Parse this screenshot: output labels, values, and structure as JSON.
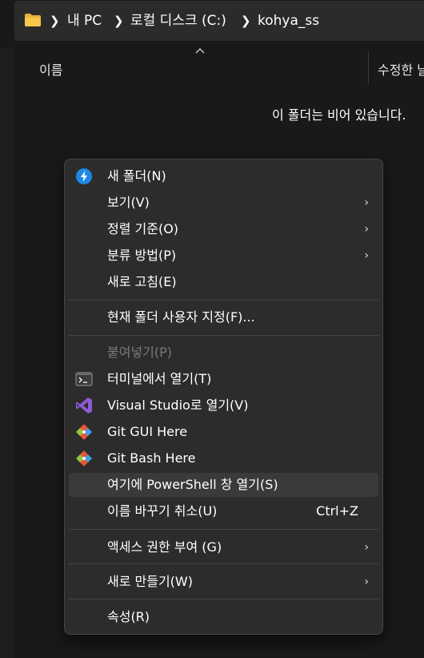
{
  "breadcrumb": {
    "items": [
      "내 PC",
      "로컬 디스크 (C:)",
      "kohya_ss"
    ]
  },
  "columns": {
    "name": "이름",
    "date": "수정한 날"
  },
  "empty_message": "이 폴더는 비어 있습니다.",
  "context_menu": {
    "items": [
      {
        "label": "새 폴더(N)",
        "icon": "new-folder-icon"
      },
      {
        "label": "보기(V)",
        "submenu": true
      },
      {
        "label": "정렬 기준(O)",
        "submenu": true
      },
      {
        "label": "분류 방법(P)",
        "submenu": true
      },
      {
        "label": "새로 고침(E)"
      },
      {
        "label": "현재 폴더 사용자 지정(F)..."
      },
      {
        "label": "붙여넣기(P)",
        "disabled": true
      },
      {
        "label": "터미널에서 열기(T)",
        "icon": "terminal-icon"
      },
      {
        "label": "Visual Studio로 열기(V)",
        "icon": "visual-studio-icon"
      },
      {
        "label": "Git GUI Here",
        "icon": "git-gui-icon"
      },
      {
        "label": "Git Bash Here",
        "icon": "git-bash-icon"
      },
      {
        "label": "여기에 PowerShell 창 열기(S)",
        "highlighted": true
      },
      {
        "label": "이름 바꾸기 취소(U)",
        "shortcut": "Ctrl+Z"
      },
      {
        "label": "액세스 권한 부여 (G)",
        "submenu": true
      },
      {
        "label": "새로 만들기(W)",
        "submenu": true
      },
      {
        "label": "속성(R)"
      }
    ]
  },
  "colors": {
    "background": "#191919",
    "menu_background": "#2c2c2c",
    "highlight": "#3a3a3a",
    "disabled_text": "#7a7a7a"
  }
}
